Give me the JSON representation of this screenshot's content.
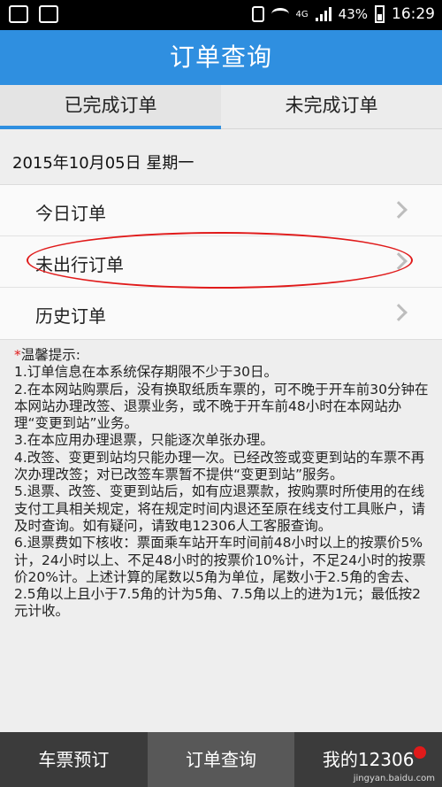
{
  "status": {
    "battery_text": "43%",
    "time": "16:29",
    "network": "4G"
  },
  "header": {
    "title": "订单查询"
  },
  "tabs": [
    {
      "label": "已完成订单",
      "active": true
    },
    {
      "label": "未完成订单",
      "active": false
    }
  ],
  "date": "2015年10月05日 星期一",
  "menu": [
    {
      "label": "今日订单"
    },
    {
      "label": "未出行订单"
    },
    {
      "label": "历史订单"
    }
  ],
  "tips": {
    "star": "*",
    "title": "温馨提示:",
    "items": [
      "1.订单信息在本系统保存期限不少于30日。",
      "2.在本网站购票后，没有换取纸质车票的，可不晚于开车前30分钟在本网站办理改签、退票业务，或不晚于开车前48小时在本网站办理“变更到站”业务。",
      "3.在本应用办理退票，只能逐次单张办理。",
      "4.改签、变更到站均只能办理一次。已经改签或变更到站的车票不再次办理改签；对已改签车票暂不提供“变更到站”服务。",
      "5.退票、改签、变更到站后，如有应退票款，按购票时所使用的在线支付工具相关规定，将在规定时间内退还至原在线支付工具账户，请及时查询。如有疑问，请致电12306人工客服查询。",
      "6.退票费如下核收：票面乘车站开车时间前48小时以上的按票价5%计，24小时以上、不足48小时的按票价10%计，不足24小时的按票价20%计。上述计算的尾数以5角为单位，尾数小于2.5角的舍去、2.5角以上且小于7.5角的计为5角、7.5角以上的进为1元；最低按2元计收。"
    ]
  },
  "bottom_nav": [
    {
      "label": "车票预订",
      "active": false
    },
    {
      "label": "订单查询",
      "active": true
    },
    {
      "label": "我的12306",
      "active": false
    }
  ],
  "watermark": "jingyan.baidu.com",
  "colors": {
    "accent": "#2f8fe0",
    "highlight": "#e01a1a"
  }
}
